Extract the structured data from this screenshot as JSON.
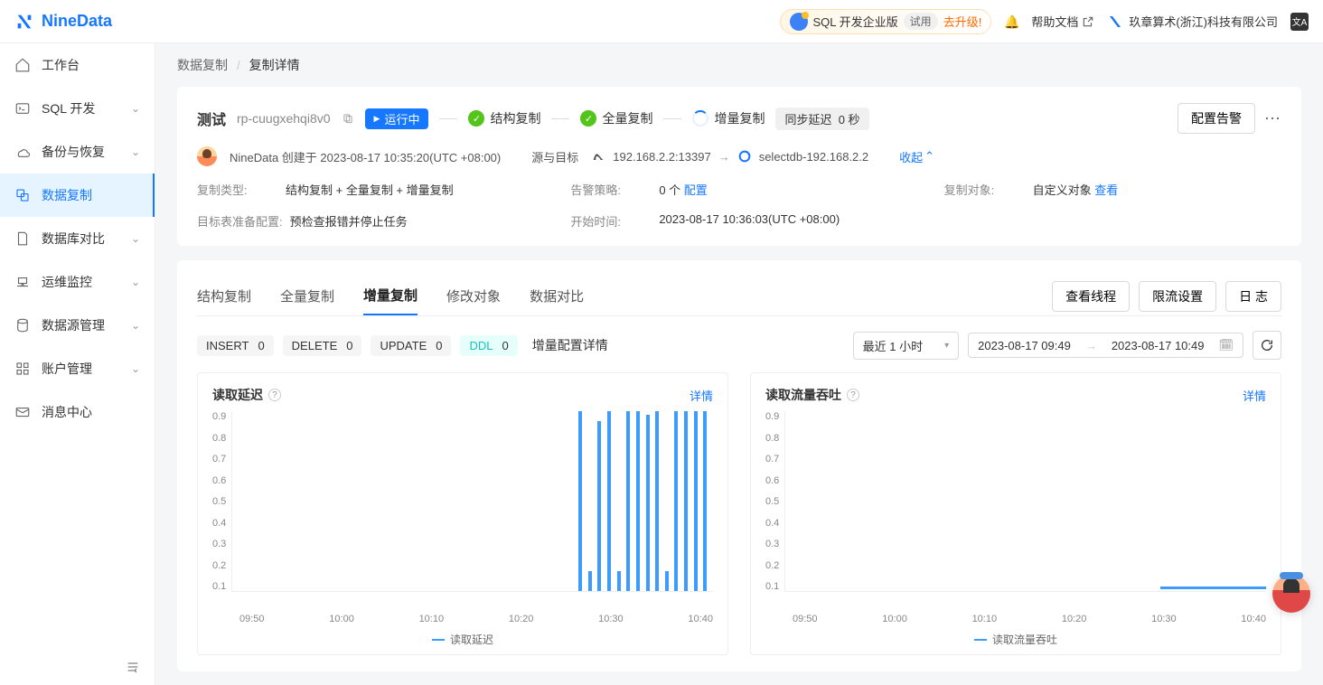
{
  "header": {
    "logo": "NineData",
    "enterprise_label": "SQL 开发企业版",
    "trial": "试用",
    "upgrade": "去升级!",
    "help": "帮助文档",
    "org": "玖章算术(浙江)科技有限公司"
  },
  "sidebar": {
    "items": [
      {
        "label": "工作台",
        "icon": "home"
      },
      {
        "label": "SQL 开发",
        "icon": "terminal",
        "chev": true
      },
      {
        "label": "备份与恢复",
        "icon": "cloud",
        "chev": true
      },
      {
        "label": "数据复制",
        "icon": "copy",
        "active": true
      },
      {
        "label": "数据库对比",
        "icon": "file",
        "chev": true
      },
      {
        "label": "运维监控",
        "icon": "monitor",
        "chev": true
      },
      {
        "label": "数据源管理",
        "icon": "db",
        "chev": true
      },
      {
        "label": "账户管理",
        "icon": "grid",
        "chev": true
      },
      {
        "label": "消息中心",
        "icon": "mail"
      }
    ]
  },
  "breadcrumb": {
    "parent": "数据复制",
    "current": "复制详情"
  },
  "detail": {
    "title": "测试",
    "id": "rp-cuugxehqi8v0",
    "status": "运行中",
    "step_struct": "结构复制",
    "step_full": "全量复制",
    "step_incr": "增量复制",
    "sync_label": "同步延迟",
    "sync_value": "0 秒",
    "config_alert": "配置告警",
    "creator": "NineData 创建于 2023-08-17 10:35:20(UTC +08:00)",
    "src_tgt_label": "源与目标",
    "source": "192.168.2.2:13397",
    "target": "selectdb-192.168.2.2",
    "collapse": "收起",
    "kv": {
      "repl_type_k": "复制类型:",
      "repl_type_v": "结构复制 + 全量复制 + 增量复制",
      "alarm_k": "告警策略:",
      "alarm_v": "0 个",
      "alarm_link": "配置",
      "obj_k": "复制对象:",
      "obj_v": "自定义对象",
      "obj_link": "查看",
      "precheck_k": "目标表准备配置:",
      "precheck_v": "预检查报错并停止任务",
      "start_k": "开始时间:",
      "start_v": "2023-08-17 10:36:03(UTC +08:00)"
    }
  },
  "tabs": {
    "items": [
      "结构复制",
      "全量复制",
      "增量复制",
      "修改对象",
      "数据对比"
    ],
    "active": "增量复制",
    "view_threads": "查看线程",
    "throttle": "限流设置",
    "log": "日 志"
  },
  "stats": {
    "insert_l": "INSERT",
    "insert_v": "0",
    "delete_l": "DELETE",
    "delete_v": "0",
    "update_l": "UPDATE",
    "update_v": "0",
    "ddl_l": "DDL",
    "ddl_v": "0",
    "cfg": "增量配置详情",
    "timerange": "最近 1 小时",
    "from": "2023-08-17 09:49",
    "to": "2023-08-17 10:49"
  },
  "chart_left": {
    "title": "读取延迟",
    "detail": "详情",
    "legend": "读取延迟"
  },
  "chart_right": {
    "title": "读取流量吞吐",
    "detail": "详情",
    "legend": "读取流量吞吐"
  },
  "chart_data": [
    {
      "type": "line",
      "name": "读取延迟",
      "title": "读取延迟",
      "xlabel": "",
      "ylabel": "",
      "ylim": [
        0,
        0.9
      ],
      "y_ticks": [
        0.1,
        0.2,
        0.3,
        0.4,
        0.5,
        0.6,
        0.7,
        0.8,
        0.9
      ],
      "x_ticks": [
        "09:50",
        "10:00",
        "10:10",
        "10:20",
        "10:30",
        "10:40"
      ],
      "series": [
        {
          "name": "读取延迟",
          "x": [
            "09:50",
            "10:00",
            "10:10",
            "10:20",
            "10:30",
            "10:36",
            "10:37",
            "10:38",
            "10:39",
            "10:40",
            "10:41",
            "10:42",
            "10:43",
            "10:44",
            "10:45",
            "10:46",
            "10:47",
            "10:48",
            "10:49"
          ],
          "values": [
            0,
            0,
            0,
            0,
            0,
            0.9,
            0.1,
            0.85,
            0.9,
            0.1,
            0.9,
            0.9,
            0.88,
            0.9,
            0.1,
            0.9,
            0.9,
            0.9,
            0.9
          ]
        }
      ]
    },
    {
      "type": "line",
      "name": "读取流量吞吐",
      "title": "读取流量吞吐",
      "xlabel": "",
      "ylabel": "",
      "ylim": [
        0,
        0.9
      ],
      "y_ticks": [
        0.1,
        0.2,
        0.3,
        0.4,
        0.5,
        0.6,
        0.7,
        0.8,
        0.9
      ],
      "x_ticks": [
        "09:50",
        "10:00",
        "10:10",
        "10:20",
        "10:30",
        "10:40"
      ],
      "series": [
        {
          "name": "读取流量吞吐",
          "x": [
            "09:50",
            "10:00",
            "10:10",
            "10:20",
            "10:30",
            "10:40",
            "10:45",
            "10:49"
          ],
          "values": [
            0,
            0,
            0,
            0,
            0,
            0,
            0.01,
            0.01
          ]
        }
      ]
    }
  ]
}
